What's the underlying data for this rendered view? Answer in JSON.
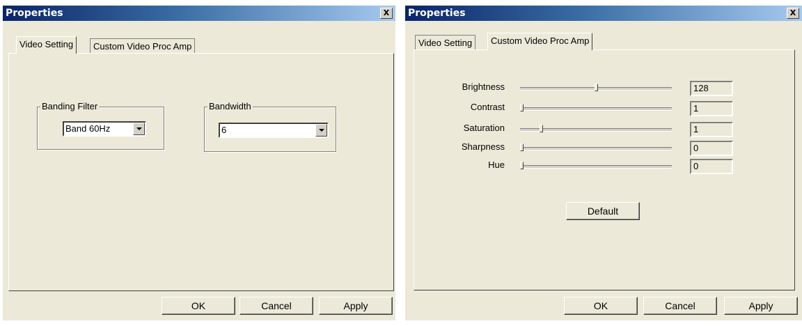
{
  "left_dialog": {
    "title": "Properties",
    "close_label": "X",
    "tabs": [
      "Video Setting",
      "Custom Video Proc Amp"
    ],
    "active_tab": "Video Setting",
    "banding_filter": {
      "label": "Banding Filter",
      "value": "Band 60Hz"
    },
    "bandwidth": {
      "label": "Bandwidth",
      "value": "6"
    },
    "buttons": {
      "ok": "OK",
      "cancel": "Cancel",
      "apply": "Apply"
    }
  },
  "right_dialog": {
    "title": "Properties",
    "close_label": "X",
    "tabs": [
      "Video Setting",
      "Custom Video Proc Amp"
    ],
    "active_tab": "Custom Video Proc Amp",
    "sliders": [
      {
        "label": "Brightness",
        "value": "128",
        "position": 0.5
      },
      {
        "label": "Contrast",
        "value": "1",
        "position": 0.0
      },
      {
        "label": "Saturation",
        "value": "1",
        "position": 0.13
      },
      {
        "label": "Sharpness",
        "value": "0",
        "position": 0.0
      },
      {
        "label": "Hue",
        "value": "0",
        "position": 0.0
      }
    ],
    "default_label": "Default",
    "buttons": {
      "ok": "OK",
      "cancel": "Cancel",
      "apply": "Apply"
    }
  },
  "colors": {
    "dialog_bg": "#ece9d8",
    "title_start": "#0a246a",
    "title_end": "#a6caf0"
  }
}
